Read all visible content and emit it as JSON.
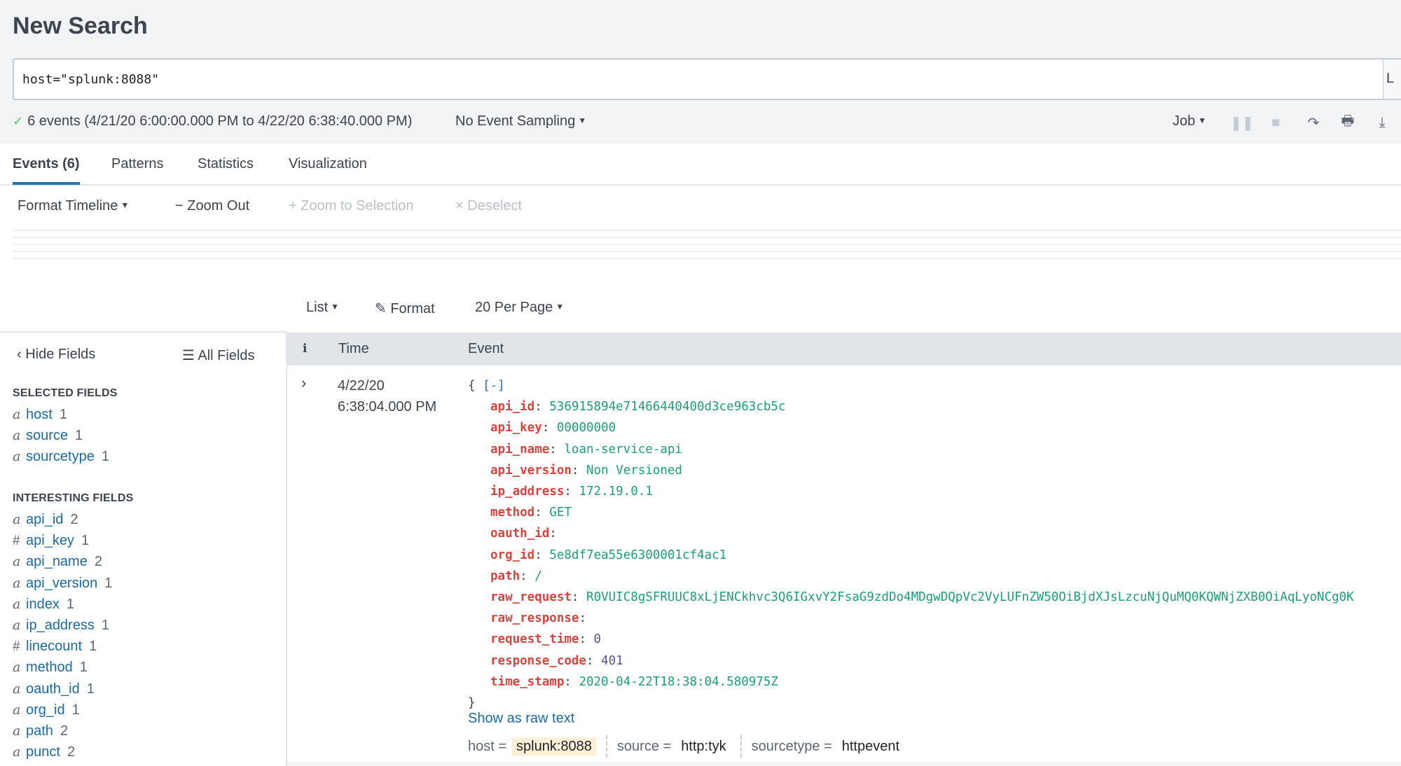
{
  "header": {
    "title": "New Search",
    "search_query": "host=\"splunk:8088\"",
    "time_picker_label": "L"
  },
  "status": {
    "icon": "check-icon",
    "check_glyph": "✓",
    "summary": "6 events (4/21/20 6:00:00.000 PM to 4/22/20 6:38:40.000 PM)",
    "sampling": "No Event Sampling",
    "job": "Job",
    "job_actions": [
      {
        "name": "pause-icon",
        "glyph": "❚❚",
        "enabled": false
      },
      {
        "name": "stop-icon",
        "glyph": "■",
        "enabled": false
      },
      {
        "name": "share-icon",
        "glyph": "↷",
        "enabled": true
      },
      {
        "name": "print-icon",
        "glyph": "🖶",
        "enabled": true
      },
      {
        "name": "export-icon",
        "glyph": "⤓",
        "enabled": true
      }
    ]
  },
  "tabs": [
    {
      "label": "Events (6)",
      "active": true
    },
    {
      "label": "Patterns",
      "active": false
    },
    {
      "label": "Statistics",
      "active": false
    },
    {
      "label": "Visualization",
      "active": false
    }
  ],
  "timeline": {
    "format": "Format Timeline",
    "zoom_out": "Zoom Out",
    "zoom_to_selection": "Zoom to Selection",
    "deselect": "Deselect"
  },
  "results_controls": {
    "list": "List",
    "format": "Format",
    "per_page": "20 Per Page"
  },
  "sidebar": {
    "hide_fields": "Hide Fields",
    "all_fields": "All Fields",
    "selected_heading": "SELECTED FIELDS",
    "selected": [
      {
        "type": "a",
        "name": "host",
        "count": "1"
      },
      {
        "type": "a",
        "name": "source",
        "count": "1"
      },
      {
        "type": "a",
        "name": "sourcetype",
        "count": "1"
      }
    ],
    "interesting_heading": "INTERESTING FIELDS",
    "interesting": [
      {
        "type": "a",
        "name": "api_id",
        "count": "2"
      },
      {
        "type": "#",
        "name": "api_key",
        "count": "1"
      },
      {
        "type": "a",
        "name": "api_name",
        "count": "2"
      },
      {
        "type": "a",
        "name": "api_version",
        "count": "1"
      },
      {
        "type": "a",
        "name": "index",
        "count": "1"
      },
      {
        "type": "a",
        "name": "ip_address",
        "count": "1"
      },
      {
        "type": "#",
        "name": "linecount",
        "count": "1"
      },
      {
        "type": "a",
        "name": "method",
        "count": "1"
      },
      {
        "type": "a",
        "name": "oauth_id",
        "count": "1"
      },
      {
        "type": "a",
        "name": "org_id",
        "count": "1"
      },
      {
        "type": "a",
        "name": "path",
        "count": "2"
      },
      {
        "type": "a",
        "name": "punct",
        "count": "2"
      }
    ]
  },
  "table": {
    "columns": [
      "i",
      "Time",
      "Event"
    ],
    "events": [
      {
        "date": "4/22/20",
        "time": "6:38:04.000 PM",
        "open_brace": "{",
        "collapse": "[-]",
        "close_brace": "}",
        "fields": [
          {
            "key": "api_id",
            "value": "536915894e71466440400d3ce963cb5c",
            "kind": "s"
          },
          {
            "key": "api_key",
            "value": "00000000",
            "kind": "s"
          },
          {
            "key": "api_name",
            "value": "loan-service-api",
            "kind": "s"
          },
          {
            "key": "api_version",
            "value": "Non Versioned",
            "kind": "s"
          },
          {
            "key": "ip_address",
            "value": "172.19.0.1",
            "kind": "s"
          },
          {
            "key": "method",
            "value": "GET",
            "kind": "s"
          },
          {
            "key": "oauth_id",
            "value": "",
            "kind": "s"
          },
          {
            "key": "org_id",
            "value": "5e8df7ea55e6300001cf4ac1",
            "kind": "s"
          },
          {
            "key": "path",
            "value": "/",
            "kind": "s"
          },
          {
            "key": "raw_request",
            "value": "R0VUIC8gSFRUUC8xLjENCkhvc3Q6IGxvY2FsaG9zdDo4MDgwDQpVc2VyLUFnZW50OiBjdXJsLzcuNjQuMQ0KQWNjZXB0OiAqLyoNCg0K",
            "kind": "s"
          },
          {
            "key": "raw_response",
            "value": "",
            "kind": "s"
          },
          {
            "key": "request_time",
            "value": "0",
            "kind": "n"
          },
          {
            "key": "response_code",
            "value": "401",
            "kind": "n"
          },
          {
            "key": "time_stamp",
            "value": "2020-04-22T18:38:04.580975Z",
            "kind": "s"
          }
        ],
        "show_raw": "Show as raw text",
        "meta": [
          {
            "label": "host =",
            "value": "splunk:8088",
            "highlight": true
          },
          {
            "label": "source =",
            "value": "http:tyk",
            "highlight": false
          },
          {
            "label": "sourcetype =",
            "value": "httpevent",
            "highlight": false
          }
        ]
      }
    ]
  }
}
